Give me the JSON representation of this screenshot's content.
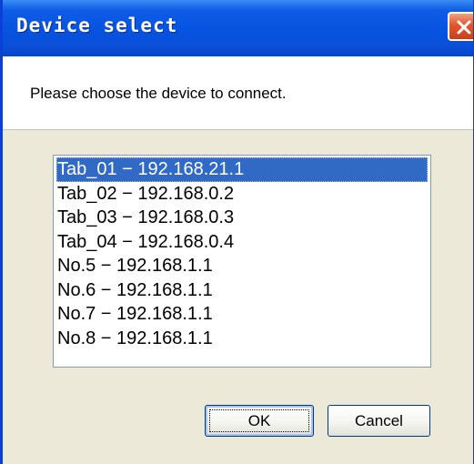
{
  "dialog": {
    "title": "Device select",
    "prompt": "Please choose the device to connect.",
    "close_icon": "close-icon"
  },
  "devices": [
    {
      "label": "Tab_01 − 192.168.21.1",
      "selected": true
    },
    {
      "label": "Tab_02 − 192.168.0.2",
      "selected": false
    },
    {
      "label": "Tab_03 − 192.168.0.3",
      "selected": false
    },
    {
      "label": "Tab_04 − 192.168.0.4",
      "selected": false
    },
    {
      "label": "No.5 − 192.168.1.1",
      "selected": false
    },
    {
      "label": "No.6 − 192.168.1.1",
      "selected": false
    },
    {
      "label": "No.7 − 192.168.1.1",
      "selected": false
    },
    {
      "label": "No.8 − 192.168.1.1",
      "selected": false
    }
  ],
  "buttons": {
    "ok_label": "OK",
    "cancel_label": "Cancel"
  },
  "colors": {
    "titlebar": "#0553e0",
    "selection": "#316ac5",
    "close": "#e2562d",
    "dialog_bg": "#ece9d8"
  }
}
